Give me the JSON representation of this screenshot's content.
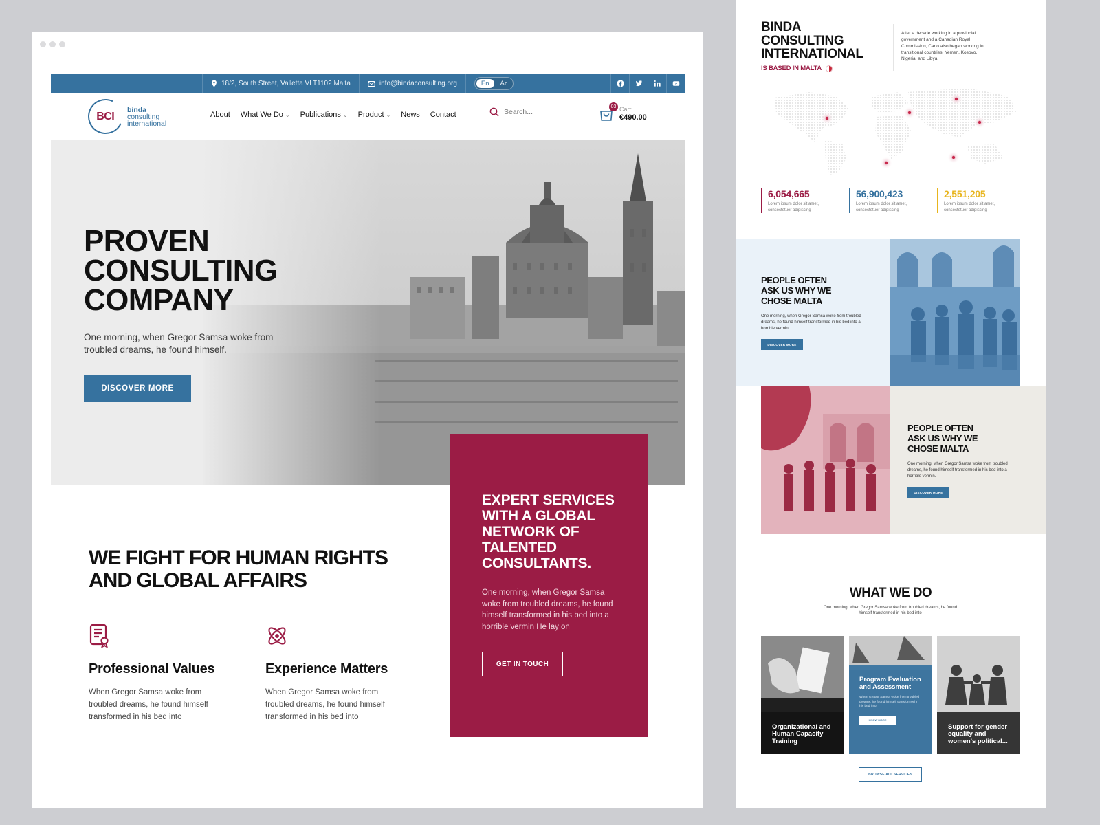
{
  "topbar": {
    "address": "18/2, South Street, Valletta VLT1102 Malta",
    "email": "info@bindaconsulting.org",
    "lang_en": "En",
    "lang_ar": "Ar"
  },
  "logo": {
    "mark": "BCI",
    "line1": "binda",
    "line2": "consulting",
    "line3": "international"
  },
  "nav": {
    "about": "About",
    "what_we_do": "What We Do",
    "publications": "Publications",
    "product": "Product",
    "news": "News",
    "contact": "Contact",
    "search_placeholder": "Search..."
  },
  "cart": {
    "count": "03",
    "label": "Cart:",
    "amount": "€490.00"
  },
  "hero": {
    "title": "PROVEN CONSULTING COMPANY",
    "subtitle": "One morning, when Gregor Samsa woke from troubled dreams, he found himself.",
    "button": "DISCOVER MORE"
  },
  "fight": {
    "title": "WE FIGHT FOR HUMAN RIGHTS AND GLOBAL AFFAIRS"
  },
  "features": [
    {
      "title": "Professional Values",
      "text": "When Gregor Samsa woke from troubled dreams, he found himself transformed in his bed into"
    },
    {
      "title": "Experience Matters",
      "text": "When Gregor Samsa woke from troubled dreams, he found himself transformed in his bed into"
    }
  ],
  "red_card": {
    "title": "EXPERT SERVICES WITH A GLOBAL NETWORK OF TALENTED CONSULTANTS.",
    "text": "One morning, when Gregor Samsa woke from troubled dreams, he found himself transformed in his bed into a horrible vermin He lay on",
    "button": "GET IN TOUCH"
  },
  "right": {
    "title": "BINDA CONSULTING INTERNATIONAL",
    "based": "IS BASED IN MALTA",
    "about": "After a decade working in a provincial government and a Canadian Royal Commission, Carlo also began working in transitional countries: Yemen, Kosovo, Nigeria, and Libya.",
    "stats": [
      {
        "value": "6,054,665",
        "text": "Lorem ipsum dolor sit amet, consectetuer adipiscing",
        "color": "#9b1c45"
      },
      {
        "value": "56,900,423",
        "text": "Lorem ipsum dolor sit amet, consectetuer adipiscing",
        "color": "#36729f"
      },
      {
        "value": "2,551,205",
        "text": "Lorem ipsum dolor sit amet, consectetuer adipiscing",
        "color": "#e8b51e"
      }
    ],
    "tile1": {
      "title": "PEOPLE OFTEN ASK US WHY WE CHOSE MALTA",
      "text": "One morning, when Gregor Samsa woke from troubled dreams, he found himself transformed in his bed into a horrible vermin.",
      "button": "DISCOVER MORE"
    },
    "tile2": {
      "title": "PEOPLE OFTEN ASK US WHY WE CHOSE MALTA",
      "text": "One morning, when Gregor Samsa woke from troubled dreams, he found himself transformed in his bed into a horrible vermin.",
      "button": "DISCOVER MORE"
    },
    "what_we_do": {
      "title": "WHAT WE DO",
      "subtitle": "One morning, when Gregor Samsa woke from troubled dreams, he found himself transformed in his bed into",
      "cards": [
        {
          "label": "Organizational and Human Capacity Training"
        },
        {
          "label": "Program Evaluation and Assessment",
          "text": "When Gregor Samsa woke from troubled dreams, he found himself transformed in his bed into.",
          "button": "KNOW MORE"
        },
        {
          "label": "Support for gender equality and women's political..."
        }
      ],
      "browse": "BROWSE ALL SERVICES"
    }
  },
  "colors": {
    "brand_blue": "#36729f",
    "brand_red": "#9b1c45",
    "accent_yellow": "#e8b51e"
  }
}
